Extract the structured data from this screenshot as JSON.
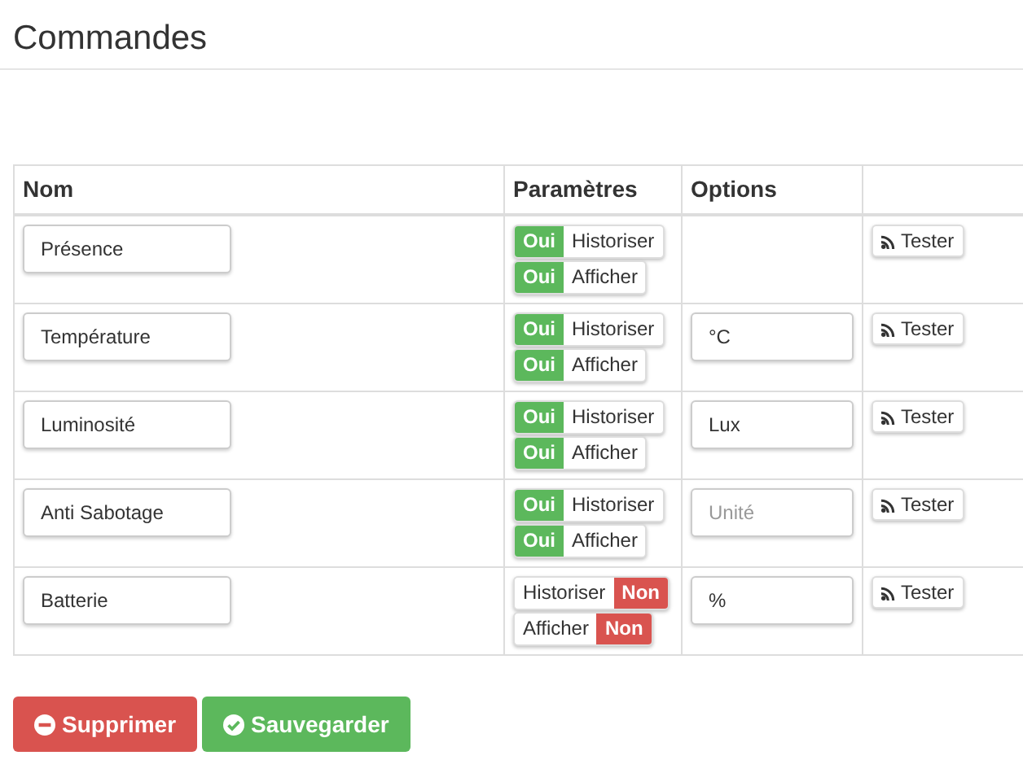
{
  "title": "Commandes",
  "table": {
    "columns": [
      "Nom",
      "Paramètres",
      "Options"
    ],
    "rows": [
      {
        "name": "Présence",
        "params": [
          {
            "state": "Oui",
            "label": "Historiser",
            "on": true
          },
          {
            "state": "Oui",
            "label": "Afficher",
            "on": true
          }
        ],
        "test": "Tester"
      },
      {
        "name": "Température",
        "params": [
          {
            "state": "Oui",
            "label": "Historiser",
            "on": true
          },
          {
            "state": "Oui",
            "label": "Afficher",
            "on": true
          }
        ],
        "option": {
          "value": "°C"
        },
        "test": "Tester"
      },
      {
        "name": "Luminosité",
        "params": [
          {
            "state": "Oui",
            "label": "Historiser",
            "on": true
          },
          {
            "state": "Oui",
            "label": "Afficher",
            "on": true
          }
        ],
        "option": {
          "value": "Lux"
        },
        "test": "Tester"
      },
      {
        "name": "Anti Sabotage",
        "params": [
          {
            "state": "Oui",
            "label": "Historiser",
            "on": true
          },
          {
            "state": "Oui",
            "label": "Afficher",
            "on": true
          }
        ],
        "option": {
          "placeholder": "Unité"
        },
        "test": "Tester"
      },
      {
        "name": "Batterie",
        "params": [
          {
            "state": "Non",
            "label": "Historiser",
            "on": false
          },
          {
            "state": "Non",
            "label": "Afficher",
            "on": false
          }
        ],
        "option": {
          "value": "%"
        },
        "test": "Tester"
      }
    ]
  },
  "buttons": [
    {
      "kind": "delete",
      "label": "Supprimer"
    },
    {
      "kind": "save",
      "label": "Sauvegarder"
    }
  ]
}
